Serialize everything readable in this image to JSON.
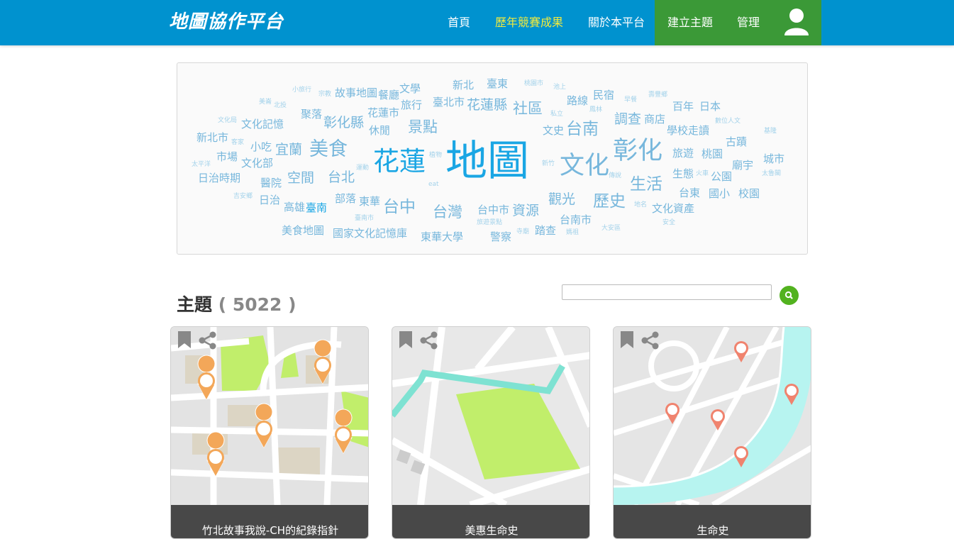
{
  "header": {
    "logo": "地圖協作平台",
    "nav": {
      "home": "首頁",
      "contest": "歷年競賽成果",
      "about": "關於本平台",
      "create": "建立主題",
      "admin": "管理"
    }
  },
  "tag_cloud": {
    "words": [
      {
        "text": "小旅行"
      },
      {
        "text": "宗教"
      },
      {
        "text": "故事地圖"
      },
      {
        "text": "餐廳"
      },
      {
        "text": "文學"
      },
      {
        "text": "新北"
      },
      {
        "text": "臺東"
      },
      {
        "text": "桃園市"
      },
      {
        "text": "池上"
      },
      {
        "text": "美崙"
      },
      {
        "text": "北投"
      },
      {
        "text": "臺北市"
      },
      {
        "text": "花蓮縣"
      },
      {
        "text": "社區"
      },
      {
        "text": "路線"
      },
      {
        "text": "民宿"
      },
      {
        "text": "早餐"
      },
      {
        "text": "壽豐鄉"
      },
      {
        "text": "聚落"
      },
      {
        "text": "旅行"
      },
      {
        "text": "花蓮市"
      },
      {
        "text": "私立"
      },
      {
        "text": "鳳林"
      },
      {
        "text": "百年"
      },
      {
        "text": "日本"
      },
      {
        "text": "文化局"
      },
      {
        "text": "文化記憶"
      },
      {
        "text": "彰化縣"
      },
      {
        "text": "休閒"
      },
      {
        "text": "景點"
      },
      {
        "text": "文史"
      },
      {
        "text": "台南"
      },
      {
        "text": "調查"
      },
      {
        "text": "商店"
      },
      {
        "text": "數位人文"
      },
      {
        "text": "新北市"
      },
      {
        "text": "客家"
      },
      {
        "text": "學校走讀"
      },
      {
        "text": "基隆"
      },
      {
        "text": "小吃"
      },
      {
        "text": "宜蘭"
      },
      {
        "text": "美食"
      },
      {
        "text": "古蹟"
      },
      {
        "text": "市場"
      },
      {
        "text": "植物"
      },
      {
        "text": "花蓮"
      },
      {
        "text": "地圖"
      },
      {
        "text": "彰化"
      },
      {
        "text": "旅遊"
      },
      {
        "text": "桃園"
      },
      {
        "text": "城市"
      },
      {
        "text": "太平洋"
      },
      {
        "text": "文化部"
      },
      {
        "text": "運動"
      },
      {
        "text": "新竹"
      },
      {
        "text": "文化"
      },
      {
        "text": "廟宇"
      },
      {
        "text": "日治時期"
      },
      {
        "text": "醫院"
      },
      {
        "text": "空間"
      },
      {
        "text": "台北"
      },
      {
        "text": "傳說"
      },
      {
        "text": "生態"
      },
      {
        "text": "火車"
      },
      {
        "text": "公園"
      },
      {
        "text": "太魯閣"
      },
      {
        "text": "eat"
      },
      {
        "text": "生活"
      },
      {
        "text": "台東"
      },
      {
        "text": "國小"
      },
      {
        "text": "校園"
      },
      {
        "text": "吉安鄉"
      },
      {
        "text": "日治"
      },
      {
        "text": "部落"
      },
      {
        "text": "東華"
      },
      {
        "text": "觀光"
      },
      {
        "text": "地名"
      },
      {
        "text": "高雄"
      },
      {
        "text": "臺南"
      },
      {
        "text": "台中"
      },
      {
        "text": "台灣"
      },
      {
        "text": "台中市"
      },
      {
        "text": "資源"
      },
      {
        "text": "歷史"
      },
      {
        "text": "文化資產"
      },
      {
        "text": "臺南市"
      },
      {
        "text": "旅遊景點"
      },
      {
        "text": "台南市"
      },
      {
        "text": "安全"
      },
      {
        "text": "美食地圖"
      },
      {
        "text": "國家文化記憶庫"
      },
      {
        "text": "東華大學"
      },
      {
        "text": "寺廟"
      },
      {
        "text": "踏查"
      },
      {
        "text": "大安區"
      },
      {
        "text": "警察"
      },
      {
        "text": "媽祖"
      }
    ]
  },
  "topics": {
    "title": "主題",
    "count": "( 5022 )",
    "search_placeholder": ""
  },
  "cards": [
    {
      "title": "竹北故事我說-CH的紀錄指針"
    },
    {
      "title": "美惠生命史"
    },
    {
      "title": "生命史"
    }
  ],
  "colors": {
    "header_bg": "#0092cf",
    "nav_highlight": "#f1ea3e",
    "create_bg": "#3b9937",
    "search_button": "#52b21f",
    "card_caption_bg": "#484848",
    "cloud_primary": "#1aa6e4",
    "cloud_light": "#a3d2ea"
  },
  "icons": [
    "user-icon",
    "search-icon",
    "bookmark-icon",
    "share-icon",
    "map-pin-icon"
  ]
}
